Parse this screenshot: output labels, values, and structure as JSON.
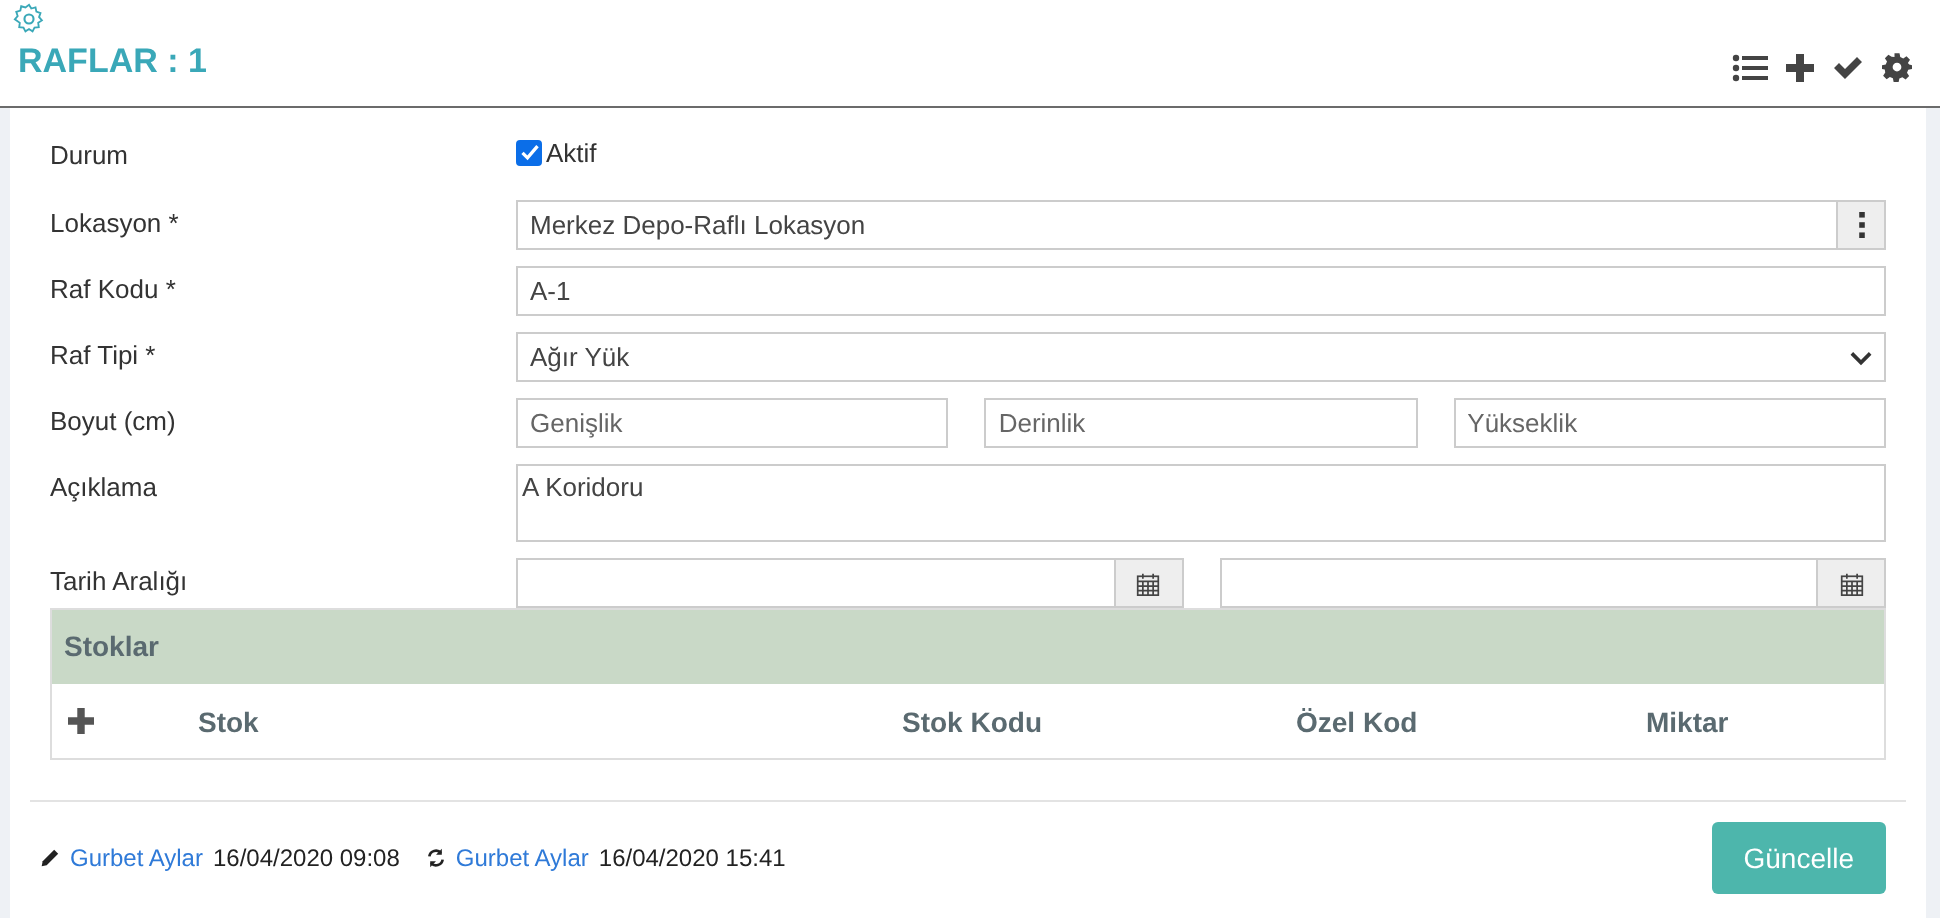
{
  "header": {
    "title": "RAFLAR : 1",
    "actions": [
      {
        "kind": "list"
      },
      {
        "kind": "add"
      },
      {
        "kind": "check"
      },
      {
        "kind": "settings"
      }
    ]
  },
  "form": {
    "status": {
      "label": "Durum",
      "checkbox_label": "Aktif",
      "checked": true
    },
    "location": {
      "label": "Lokasyon *",
      "value": "Merkez Depo-Raflı Lokasyon"
    },
    "code": {
      "label": "Raf Kodu *",
      "value": "A-1"
    },
    "type": {
      "label": "Raf Tipi *",
      "value": "Ağır Yük"
    },
    "size": {
      "label": "Boyut (cm)",
      "fields": [
        {
          "placeholder": "Genişlik"
        },
        {
          "placeholder": "Derinlik"
        },
        {
          "placeholder": "Yükseklik"
        }
      ]
    },
    "description": {
      "label": "Açıklama",
      "value": "A Koridoru"
    },
    "date_range": {
      "label": "Tarih Aralığı"
    }
  },
  "stocks": {
    "title": "Stoklar",
    "columns": [
      "Stok",
      "Stok Kodu",
      "Özel Kod",
      "Miktar"
    ]
  },
  "footer": {
    "created_by": "Gurbet Aylar",
    "created_at": "16/04/2020 09:08",
    "updated_by": "Gurbet Aylar",
    "updated_at": "16/04/2020 15:41",
    "button": "Güncelle"
  }
}
